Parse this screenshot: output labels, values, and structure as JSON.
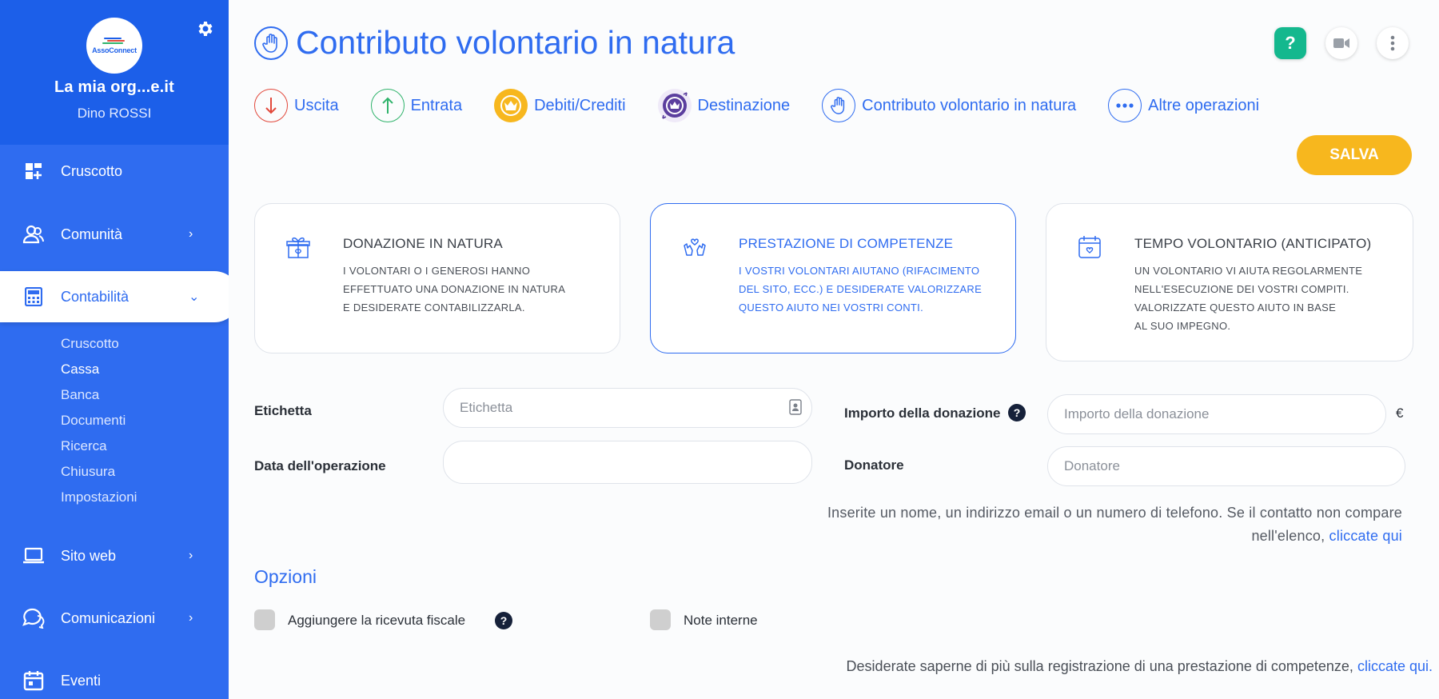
{
  "sidebar": {
    "logo_text": "AssoConnect",
    "org_name": "La mia org...e.it",
    "user_name": "Dino ROSSI",
    "items": [
      {
        "label": "Cruscotto"
      },
      {
        "label": "Comunità"
      },
      {
        "label": "Contabilità"
      },
      {
        "label": "Sito web"
      },
      {
        "label": "Comunicazioni"
      },
      {
        "label": "Eventi"
      }
    ],
    "sub_items": [
      "Cruscotto",
      "Cassa",
      "Banca",
      "Documenti",
      "Ricerca",
      "Chiusura",
      "Impostazioni"
    ]
  },
  "header": {
    "title": "Contributo volontario in natura",
    "help_label": "?"
  },
  "operations": [
    {
      "label": "Uscita"
    },
    {
      "label": "Entrata"
    },
    {
      "label": "Debiti/Crediti"
    },
    {
      "label": "Destinazione"
    },
    {
      "label": "Contributo volontario in natura"
    },
    {
      "label": "Altre operazioni"
    }
  ],
  "save_label": "SALVA",
  "cards": [
    {
      "title": "DONAZIONE IN NATURA",
      "lines": [
        "I VOLONTARI O I GENEROSI HANNO",
        "EFFETTUATO UNA DONAZIONE IN NATURA",
        "E DESIDERATE CONTABILIZZARLA."
      ]
    },
    {
      "title": "PRESTAZIONE DI COMPETENZE",
      "lines": [
        "I VOSTRI VOLONTARI AIUTANO (RIFACIMENTO",
        "DEL SITO, ECC.) E DESIDERATE VALORIZZARE",
        "QUESTO AIUTO NEI VOSTRI CONTI."
      ]
    },
    {
      "title": "TEMPO VOLONTARIO (ANTICIPATO)",
      "lines": [
        "UN VOLONTARIO VI AIUTA REGOLARMENTE",
        "NELL'ESECUZIONE DEI VOSTRI COMPITI.",
        "VALORIZZATE QUESTO AIUTO IN BASE",
        "AL SUO IMPEGNO."
      ]
    }
  ],
  "form": {
    "label_label": "Etichetta",
    "label_placeholder": "Etichetta",
    "date_label": "Data dell'operazione",
    "date_value": "",
    "amount_label": "Importo della donazione",
    "amount_placeholder": "Importo della donazione",
    "currency": "€",
    "donor_label": "Donatore",
    "donor_placeholder": "Donatore",
    "hint_text": "Inserite un nome, un indirizzo email o un numero di telefono. Se il contatto non compare nell'elenco,",
    "hint_link": "cliccate qui"
  },
  "options": {
    "section_title": "Opzioni",
    "receipt_label": "Aggiungere la ricevuta fiscale",
    "notes_label": "Note interne"
  },
  "footer": {
    "text": "Desiderate saperne di più sulla registrazione di una prestazione di competenze,",
    "link": "cliccate qui."
  },
  "colors": {
    "primary": "#2f6cf0",
    "sidebar_dark": "#1c5fe9",
    "save": "#f7b71e",
    "help": "#14b88e",
    "exit": "#e2483b",
    "entry": "#2fb36b",
    "debts": "#f7b71e",
    "destination": "#5b3e9e"
  }
}
